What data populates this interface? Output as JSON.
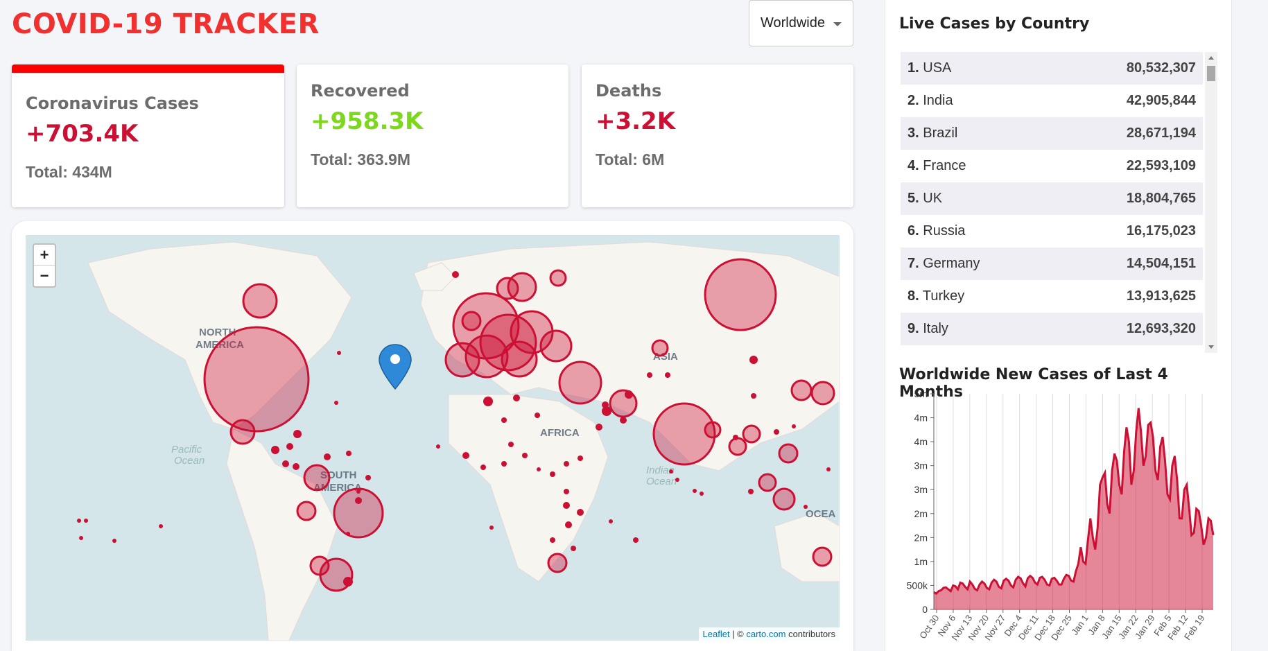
{
  "header": {
    "title": "COVID-19 TRACKER",
    "country_select": "Worldwide"
  },
  "cards": [
    {
      "title": "Coronavirus Cases",
      "today": "+703.4K",
      "total": "Total: 434M",
      "color": "#cc1034"
    },
    {
      "title": "Recovered",
      "today": "+958.3K",
      "total": "Total: 363.9M",
      "color": "#7dd71d"
    },
    {
      "title": "Deaths",
      "today": "+3.2K",
      "total": "Total: 6M",
      "color": "#cc1034"
    }
  ],
  "map": {
    "zoom_in": "+",
    "zoom_out": "−",
    "labels": [
      "NORTH",
      "AMERICA",
      "SOUTH",
      "AMERICA",
      "AFRICA",
      "ASIA",
      "Pacific",
      "Ocean",
      "Indian",
      "Ocean",
      "OCEA"
    ],
    "attribution": {
      "leaflet": "Leaflet",
      "sep": " | © ",
      "carto": "carto.com",
      "suffix": " contributors"
    },
    "circle_color": "#cc1034"
  },
  "live_cases": {
    "title": "Live Cases by Country",
    "rows": [
      {
        "rank": "1.",
        "country": "USA",
        "cases": "80,532,307"
      },
      {
        "rank": "2.",
        "country": "India",
        "cases": "42,905,844"
      },
      {
        "rank": "3.",
        "country": "Brazil",
        "cases": "28,671,194"
      },
      {
        "rank": "4.",
        "country": "France",
        "cases": "22,593,109"
      },
      {
        "rank": "5.",
        "country": "UK",
        "cases": "18,804,765"
      },
      {
        "rank": "6.",
        "country": "Russia",
        "cases": "16,175,023"
      },
      {
        "rank": "7.",
        "country": "Germany",
        "cases": "14,504,151"
      },
      {
        "rank": "8.",
        "country": "Turkey",
        "cases": "13,913,625"
      },
      {
        "rank": "9.",
        "country": "Italy",
        "cases": "12,693,320"
      }
    ]
  },
  "chart_title": "Worldwide New Cases of Last 4 Months",
  "chart_data": {
    "type": "area",
    "title": "Worldwide New Cases of Last 4 Months",
    "xlabel": "",
    "ylabel": "",
    "ylim": [
      0,
      4500000
    ],
    "y_tick_values": [
      0,
      500000,
      1000000,
      1500000,
      2000000,
      2500000,
      3000000,
      3500000,
      4000000,
      4500000
    ],
    "y_tick_labels": [
      "0",
      "500k",
      "1m",
      "2m",
      "2m",
      "3m",
      "3m",
      "4m",
      "4m",
      "5m"
    ],
    "x_tick_labels": [
      "Oct 30",
      "Nov 6",
      "Nov 13",
      "Nov 20",
      "Nov 27",
      "Dec 4",
      "Dec 11",
      "Dec 18",
      "Dec 25",
      "Jan 1",
      "Jan 8",
      "Jan 15",
      "Jan 22",
      "Jan 29",
      "Feb 5",
      "Feb 12",
      "Feb 19"
    ],
    "grid": "vertical",
    "color": "#cc1034",
    "values": [
      360000,
      330000,
      380000,
      400000,
      450000,
      460000,
      420000,
      380000,
      500000,
      480000,
      420000,
      560000,
      540000,
      470000,
      420000,
      580000,
      520000,
      430000,
      400000,
      520000,
      580000,
      540000,
      450000,
      420000,
      560000,
      620000,
      580000,
      470000,
      440000,
      600000,
      640000,
      600000,
      500000,
      460000,
      620000,
      680000,
      650000,
      550000,
      480000,
      650000,
      700000,
      660000,
      560000,
      520000,
      660000,
      680000,
      620000,
      520000,
      500000,
      640000,
      660000,
      600000,
      520000,
      520000,
      640000,
      720000,
      700000,
      600000,
      580000,
      800000,
      950000,
      1300000,
      1000000,
      950000,
      1450000,
      1900000,
      1500000,
      1250000,
      1700000,
      2600000,
      2750000,
      2850000,
      2200000,
      2000000,
      2900000,
      3250000,
      3100000,
      2600000,
      2400000,
      3300000,
      3800000,
      3500000,
      2600000,
      2900000,
      3700000,
      4200000,
      3700000,
      3000000,
      3200000,
      3850000,
      3900000,
      3600000,
      2900000,
      2700000,
      3400000,
      3600000,
      3100000,
      2400000,
      2300000,
      3000000,
      3200000,
      2700000,
      1900000,
      1900000,
      2500000,
      2600000,
      2100000,
      1550000,
      1600000,
      2100000,
      2050000,
      1750000,
      1350000,
      1500000,
      1900000,
      1850000,
      1550000
    ]
  }
}
